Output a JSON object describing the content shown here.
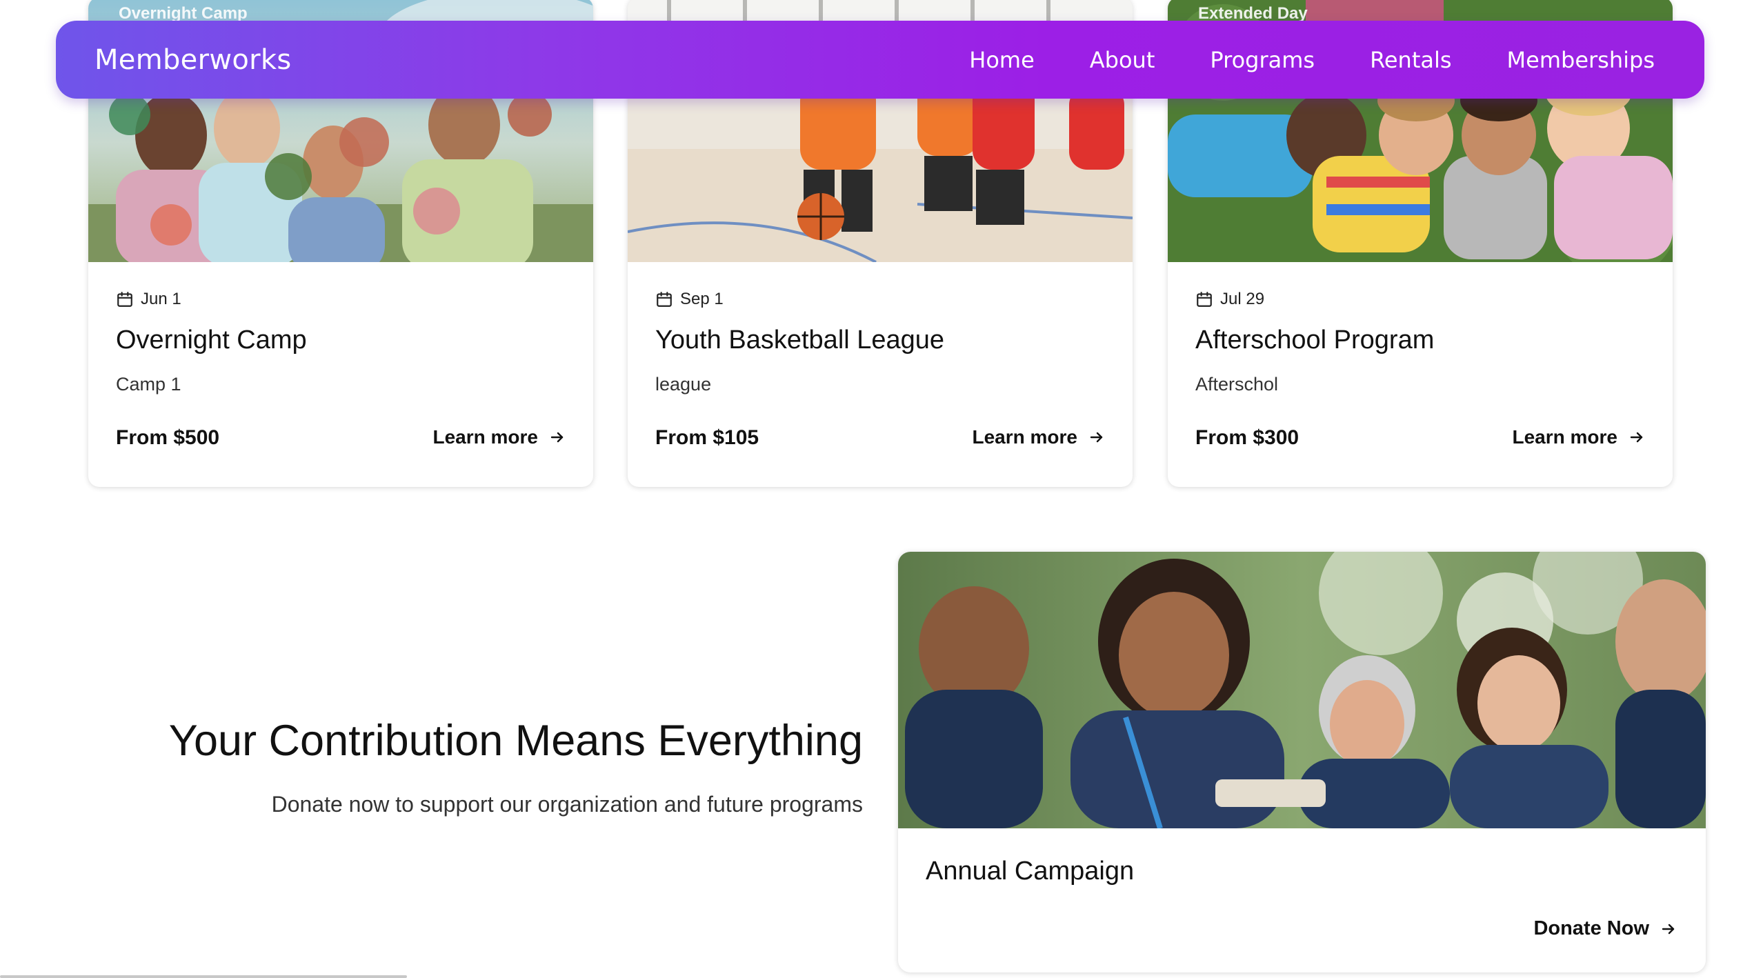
{
  "nav": {
    "brand": "Memberworks",
    "links": [
      "Home",
      "About",
      "Programs",
      "Rentals",
      "Memberships"
    ]
  },
  "programs": [
    {
      "image_caption": "Overnight Camp",
      "date": "Jun 1",
      "title": "Overnight Camp",
      "subtitle": "Camp 1",
      "price": "From $500",
      "cta": "Learn more"
    },
    {
      "image_caption": "",
      "date": "Sep 1",
      "title": "Youth Basketball League",
      "subtitle": "league",
      "price": "From $105",
      "cta": "Learn more"
    },
    {
      "image_caption": "Extended Day",
      "date": "Jul 29",
      "title": "Afterschool Program",
      "subtitle": "Afterschol",
      "price": "From $300",
      "cta": "Learn more"
    }
  ],
  "donation": {
    "heading": "Your Contribution Means Everything",
    "subtext": "Donate now to support our organization and future programs"
  },
  "campaign": {
    "title": "Annual Campaign",
    "cta": "Donate Now"
  },
  "icons": {
    "date": "calendar-icon",
    "cta_arrow": "arrow-right-icon"
  },
  "colors": {
    "nav_gradient_start": "#6f55ea",
    "nav_gradient_end": "#9a22e2",
    "text": "#111111"
  }
}
